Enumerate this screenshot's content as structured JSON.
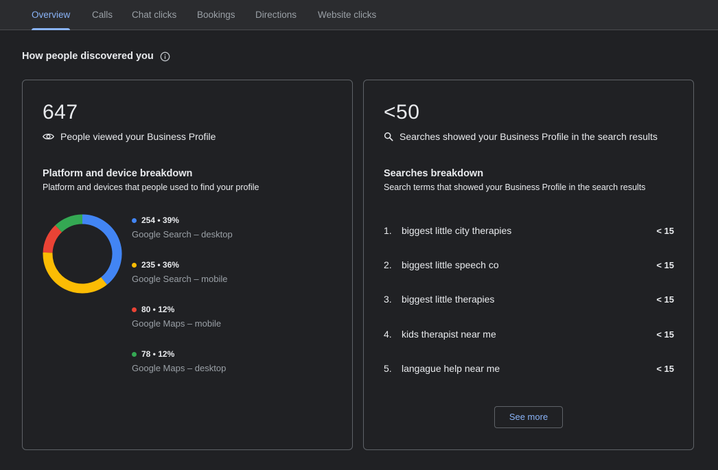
{
  "tabs": [
    {
      "label": "Overview",
      "active": true
    },
    {
      "label": "Calls"
    },
    {
      "label": "Chat clicks"
    },
    {
      "label": "Bookings"
    },
    {
      "label": "Directions"
    },
    {
      "label": "Website clicks"
    }
  ],
  "section": {
    "title": "How people discovered you",
    "info_icon": "info-icon"
  },
  "views_card": {
    "count": "647",
    "icon": "eye-icon",
    "label": "People viewed your Business Profile",
    "breakdown_title": "Platform and device breakdown",
    "breakdown_subtitle": "Platform and devices that people used to find your profile",
    "legend": [
      {
        "value": "254 • 39%",
        "label": "Google Search – desktop",
        "color": "#4285f4"
      },
      {
        "value": "235 • 36%",
        "label": "Google Search – mobile",
        "color": "#fbbc04"
      },
      {
        "value": "80 • 12%",
        "label": "Google Maps – mobile",
        "color": "#ea4335"
      },
      {
        "value": "78 • 12%",
        "label": "Google Maps – desktop",
        "color": "#34a853"
      }
    ]
  },
  "chart_data": {
    "type": "pie",
    "categories": [
      "Google Search – desktop",
      "Google Search – mobile",
      "Google Maps – mobile",
      "Google Maps – desktop"
    ],
    "values": [
      254,
      235,
      80,
      78
    ],
    "colors": [
      "#4285f4",
      "#fbbc04",
      "#ea4335",
      "#34a853"
    ]
  },
  "searches_card": {
    "count": "<50",
    "icon": "search-icon",
    "label": "Searches showed your Business Profile in the search results",
    "breakdown_title": "Searches breakdown",
    "breakdown_subtitle": "Search terms that showed your Business Profile in the search results",
    "terms": [
      {
        "num": "1.",
        "term": "biggest little city therapies",
        "count": "< 15"
      },
      {
        "num": "2.",
        "term": "biggest little speech co",
        "count": "< 15"
      },
      {
        "num": "3.",
        "term": "biggest little therapies",
        "count": "< 15"
      },
      {
        "num": "4.",
        "term": "kids therapist near me",
        "count": "< 15"
      },
      {
        "num": "5.",
        "term": "langague help near me",
        "count": "< 15"
      }
    ],
    "see_more_label": "See more"
  }
}
